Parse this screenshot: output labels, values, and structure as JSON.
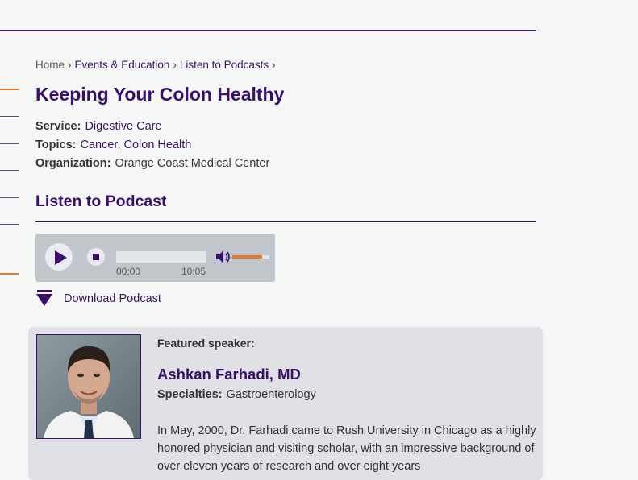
{
  "breadcrumb": {
    "home": "Home",
    "events": "Events & Education",
    "podcasts": "Listen to Podcasts",
    "separator": "›"
  },
  "page_title": "Keeping Your Colon Healthy",
  "meta": {
    "service_label": "Service:",
    "service_value": "Digestive Care",
    "topics_label": "Topics:",
    "topic_1": "Cancer",
    "topic_sep": ",",
    "topic_2": "Colon Health",
    "organization_label": "Organization:",
    "organization_value": "Orange Coast Medical Center"
  },
  "podcast": {
    "heading": "Listen to Podcast",
    "current_time": "00:00",
    "duration": "10:05",
    "progress": 0,
    "volume_fraction": 0.8,
    "download_label": "Download Podcast"
  },
  "speaker": {
    "featured_label": "Featured speaker:",
    "name": "Ashkan Farhadi, MD",
    "specialties_label": "Specialties:",
    "specialties_value": "Gastroenterology",
    "bio": "In May, 2000, Dr. Farhadi came to Rush University in Chicago as a highly honored physician and visiting scholar, with an impressive background of over eleven years of research and over eight years"
  },
  "colors": {
    "brand_purple": "#3a0e6b",
    "accent_orange": "#e07a2a",
    "player_bg": "#c1c6cc",
    "card_bg": "#dfe1e5"
  }
}
